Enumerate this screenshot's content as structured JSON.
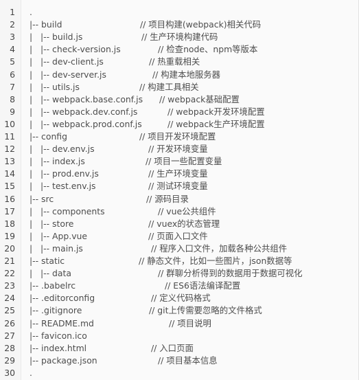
{
  "lines": [
    {
      "n": "1",
      "code": ".",
      "comment": ""
    },
    {
      "n": "2",
      "code": "|-- build",
      "comment": "// 项目构建(webpack)相关代码"
    },
    {
      "n": "3",
      "code": "|   |-- build.js",
      "comment": "// 生产环境构建代码"
    },
    {
      "n": "4",
      "code": "|   |-- check-version.js",
      "comment": "// 检查node、npm等版本"
    },
    {
      "n": "5",
      "code": "|   |-- dev-client.js",
      "comment": "// 热重载相关"
    },
    {
      "n": "6",
      "code": "|   |-- dev-server.js",
      "comment": "// 构建本地服务器"
    },
    {
      "n": "7",
      "code": "|   |-- utils.js",
      "comment": "// 构建工具相关"
    },
    {
      "n": "8",
      "code": "|   |-- webpack.base.conf.js",
      "comment": "// webpack基础配置"
    },
    {
      "n": "9",
      "code": "|   |-- webpack.dev.conf.js",
      "comment": "// webpack开发环境配置"
    },
    {
      "n": "10",
      "code": "|   |-- webpack.prod.conf.js",
      "comment": "// webpack生产环境配置"
    },
    {
      "n": "11",
      "code": "|-- config",
      "comment": "// 项目开发环境配置"
    },
    {
      "n": "12",
      "code": "|   |-- dev.env.js",
      "comment": "// 开发环境变量"
    },
    {
      "n": "13",
      "code": "|   |-- index.js",
      "comment": "// 项目一些配置变量"
    },
    {
      "n": "14",
      "code": "|   |-- prod.env.js",
      "comment": "// 生产环境变量"
    },
    {
      "n": "15",
      "code": "|   |-- test.env.js",
      "comment": "// 测试环境变量"
    },
    {
      "n": "16",
      "code": "|-- src",
      "comment": "// 源码目录"
    },
    {
      "n": "17",
      "code": "|   |-- components",
      "comment": "// vue公共组件"
    },
    {
      "n": "18",
      "code": "|   |-- store",
      "comment": "// vuex的状态管理"
    },
    {
      "n": "19",
      "code": "|   |-- App.vue",
      "comment": "// 页面入口文件"
    },
    {
      "n": "20",
      "code": "|   |-- main.js",
      "comment": "// 程序入口文件，加载各种公共组件"
    },
    {
      "n": "21",
      "code": "|-- static",
      "comment": "// 静态文件，比如一些图片，json数据等"
    },
    {
      "n": "22",
      "code": "|   |-- data",
      "comment": "// 群聊分析得到的数据用于数据可视化"
    },
    {
      "n": "23",
      "code": "|-- .babelrc",
      "comment": "// ES6语法编译配置"
    },
    {
      "n": "24",
      "code": "|-- .editorconfig",
      "comment": "// 定义代码格式"
    },
    {
      "n": "25",
      "code": "|-- .gitignore",
      "comment": "// git上传需要忽略的文件格式"
    },
    {
      "n": "26",
      "code": "|-- README.md",
      "comment": "// 项目说明"
    },
    {
      "n": "27",
      "code": "|-- favicon.ico",
      "comment": ""
    },
    {
      "n": "28",
      "code": "|-- index.html",
      "comment": "// 入口页面"
    },
    {
      "n": "29",
      "code": "|-- package.json",
      "comment": "// 项目基本信息"
    },
    {
      "n": "30",
      "code": ".",
      "comment": ""
    }
  ]
}
